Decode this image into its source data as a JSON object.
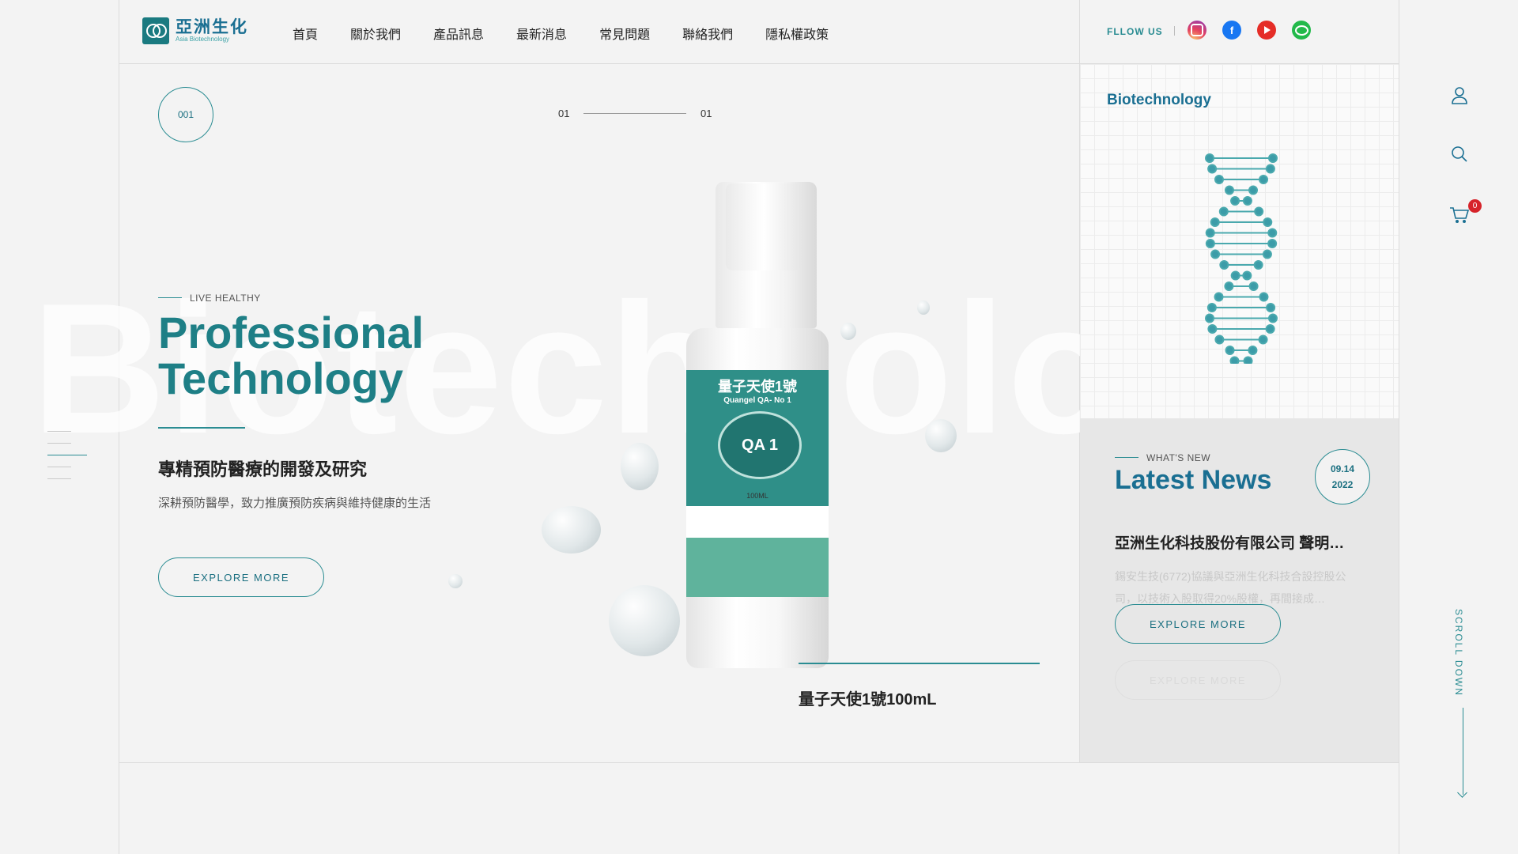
{
  "brand": {
    "name_cn": "亞洲生化",
    "name_en": "Asia Biotechnology"
  },
  "nav": [
    {
      "label": "首頁"
    },
    {
      "label": "關於我們"
    },
    {
      "label": "產品訊息"
    },
    {
      "label": "最新消息"
    },
    {
      "label": "常見問題"
    },
    {
      "label": "聯絡我們"
    },
    {
      "label": "隱私權政策"
    }
  ],
  "follow": {
    "label": "FLLOW US",
    "links": [
      "instagram-icon",
      "facebook-icon",
      "youtube-icon",
      "line-icon"
    ]
  },
  "hero": {
    "slide_number": "001",
    "pager_current": "01",
    "pager_total": "01",
    "background_word": "Biotechnology",
    "eyebrow": "LIVE HEALTHY",
    "title_line1": "Professional",
    "title_line2": "Technology",
    "subtitle": "專精預防醫療的開發及研究",
    "description": "深耕預防醫學，致力推廣預防疾病與維持健康的生活",
    "button_label": "EXPLORE MORE"
  },
  "product": {
    "name": "量子天使1號100mL",
    "label_title": "量子天使1號",
    "label_sub": "Quangel QA- No 1",
    "badge": "QA 1",
    "volume": "100ML"
  },
  "biotech_panel": {
    "label": "Biotechnology"
  },
  "news": {
    "eyebrow": "WHAT'S NEW",
    "title": "Latest News",
    "date_day": "09.14",
    "date_year": "2022",
    "headline": "亞洲生化科技股份有限公司 聲明…",
    "excerpt": "錫安生技(6772)協議與亞洲生化科技合設控股公司，以技術入股取得20%股權，再間接成…",
    "button_label": "EXPLORE MORE",
    "ghost_button_label": "EXPLORE MORE"
  },
  "utility": {
    "cart_count": "0",
    "scroll_label": "SCROLL DOWN"
  },
  "colors": {
    "teal": "#2a8c92",
    "navy": "#1a6f92",
    "badge_red": "#d6232a"
  }
}
